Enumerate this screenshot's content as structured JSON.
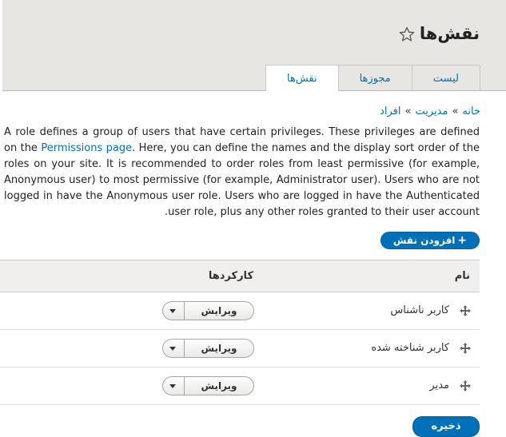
{
  "header": {
    "title": "نقش‌ها",
    "tabs": [
      {
        "label": "لیست"
      },
      {
        "label": "مجوزها"
      },
      {
        "label": "نقش‌ها"
      }
    ]
  },
  "breadcrumb": [
    "خانه",
    "مدیریت",
    "افراد"
  ],
  "breadcrumb_separator": "»",
  "description": {
    "before_link": "A role defines a group of users that have certain privileges. These privileges are defined on the ",
    "link": "Permissions page",
    "after_link": ". Here, you can define the names and the display sort order of the roles on your site. It is recommended to order roles from least permissive (for example, Anonymous user) to most permissive (for example, Administrator user). Users who are not logged in have the Anonymous user role. Users who are logged in have the Authenticated user role, plus any other roles granted to their user account."
  },
  "add_role": {
    "icon": "+",
    "label": "افزودن نقش"
  },
  "table": {
    "headers": {
      "name": "نام",
      "operations": "کارکردها"
    },
    "rows": [
      {
        "name": "کاربر ناشناس",
        "operation": "ویرایش"
      },
      {
        "name": "کاربر شناخته شده",
        "operation": "ویرایش"
      },
      {
        "name": "مدیر",
        "operation": "ویرایش"
      }
    ]
  },
  "save_label": "ذخیره",
  "colors": {
    "accent": "#0071b8",
    "link": "#0071b3",
    "header_bg": "#e7e6e2"
  }
}
